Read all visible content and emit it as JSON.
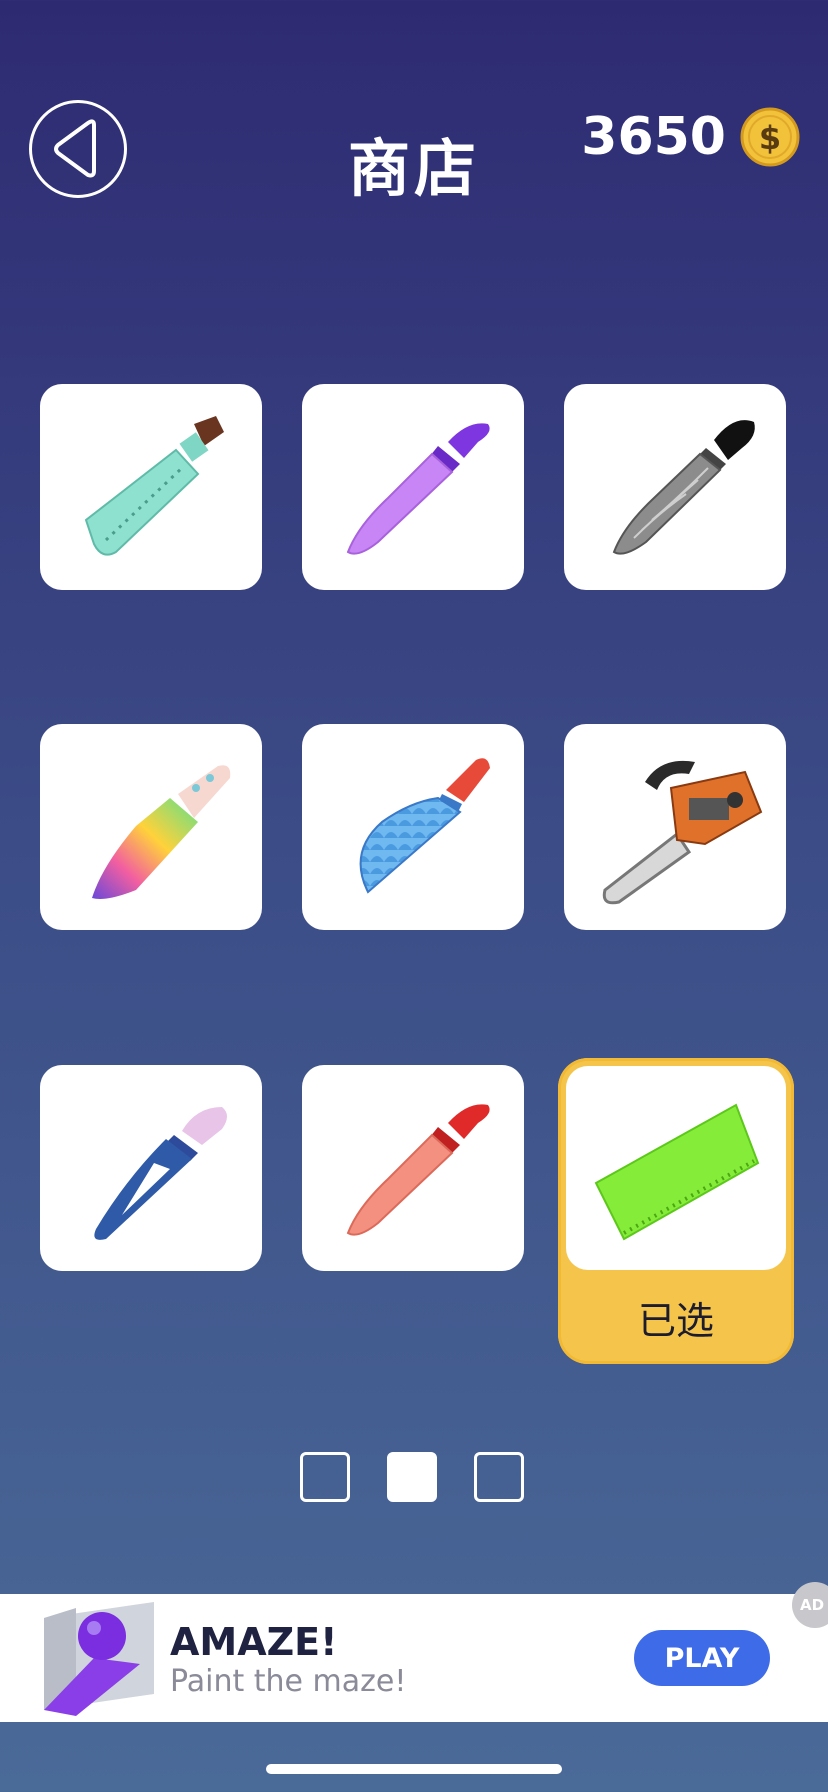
{
  "header": {
    "title": "商店",
    "coins": "3650"
  },
  "shop": {
    "items": [
      {
        "icon": "cleaver-knife-teal-icon"
      },
      {
        "icon": "chef-knife-purple-icon"
      },
      {
        "icon": "damascus-knife-icon"
      },
      {
        "icon": "rainbow-knife-icon"
      },
      {
        "icon": "scaled-blade-knife-icon"
      },
      {
        "icon": "chainsaw-icon"
      },
      {
        "icon": "hollow-blue-knife-icon"
      },
      {
        "icon": "chef-knife-red-icon"
      },
      {
        "icon": "green-ruler-blade-icon"
      }
    ],
    "selected_label": "已选",
    "selected_index": 8
  },
  "pager": {
    "pages": 3,
    "active": 2
  },
  "ad": {
    "title": "AMAZE!",
    "subtitle": "Paint the maze!",
    "cta": "PLAY",
    "badge": "AD"
  },
  "colors": {
    "accent_selected": "#f5c54b",
    "play_button": "#3e6be8",
    "coin": "#f2c23a"
  }
}
